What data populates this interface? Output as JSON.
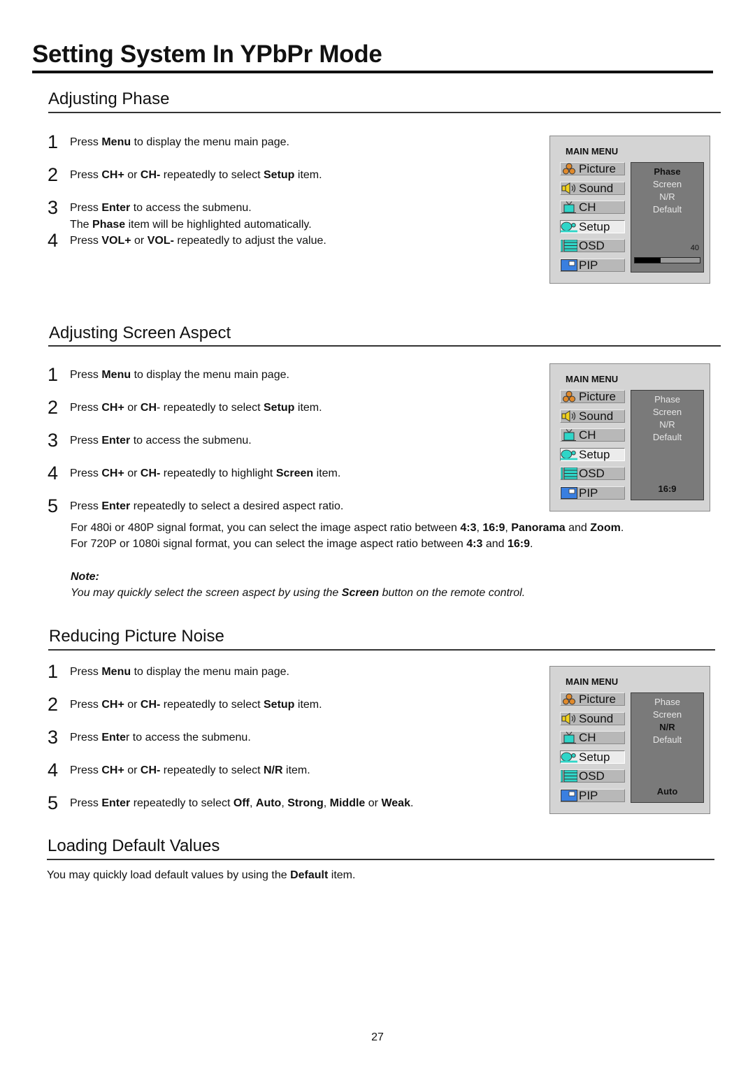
{
  "page": {
    "title": "Setting System In YPbPr Mode",
    "page_number": "27"
  },
  "sections": {
    "phase": {
      "title": "Adjusting Phase",
      "steps": [
        {
          "num": "1",
          "parts": [
            [
              "Press ",
              false
            ],
            [
              "Menu",
              true
            ],
            [
              " to display the menu main page.",
              false
            ]
          ]
        },
        {
          "num": "2",
          "parts": [
            [
              "Press ",
              false
            ],
            [
              "CH+",
              true
            ],
            [
              " or ",
              false
            ],
            [
              "CH-",
              true
            ],
            [
              " repeatedly to select ",
              false
            ],
            [
              "Setup",
              true
            ],
            [
              " item.",
              false
            ]
          ]
        },
        {
          "num": "3",
          "parts": [
            [
              "Press ",
              false
            ],
            [
              "Enter",
              true
            ],
            [
              " to access the submenu.",
              false
            ]
          ],
          "extra": [
            [
              "The ",
              false
            ],
            [
              "Phase",
              true
            ],
            [
              " item will be highlighted automatically.",
              false
            ]
          ]
        },
        {
          "num": "4",
          "parts": [
            [
              "Press ",
              false
            ],
            [
              "VOL+",
              true
            ],
            [
              " or ",
              false
            ],
            [
              "VOL-",
              true
            ],
            [
              " repeatedly to adjust the value.",
              false
            ]
          ]
        }
      ]
    },
    "screen": {
      "title": "Adjusting Screen Aspect",
      "steps": [
        {
          "num": "1",
          "parts": [
            [
              "Press ",
              false
            ],
            [
              "Menu",
              true
            ],
            [
              " to display the menu main page.",
              false
            ]
          ]
        },
        {
          "num": "2",
          "parts": [
            [
              "Press ",
              false
            ],
            [
              "CH+",
              true
            ],
            [
              " or ",
              false
            ],
            [
              "CH",
              true
            ],
            [
              "- repeatedly to select ",
              false
            ],
            [
              "Setup",
              true
            ],
            [
              " item.",
              false
            ]
          ]
        },
        {
          "num": "3",
          "parts": [
            [
              "Press ",
              false
            ],
            [
              "Enter",
              true
            ],
            [
              " to access the submenu.",
              false
            ]
          ]
        },
        {
          "num": "4",
          "parts": [
            [
              "Press ",
              false
            ],
            [
              "CH+",
              true
            ],
            [
              " or ",
              false
            ],
            [
              "CH-",
              true
            ],
            [
              " repeatedly to highlight ",
              false
            ],
            [
              "Screen",
              true
            ],
            [
              " item.",
              false
            ]
          ]
        },
        {
          "num": "5",
          "parts": [
            [
              "Press ",
              false
            ],
            [
              "Enter",
              true
            ],
            [
              " repeatedly to select a desired aspect ratio.",
              false
            ]
          ]
        }
      ],
      "paragraphs": [
        [
          [
            "For 480i or 480P signal format, you can select the image aspect ratio between ",
            false
          ],
          [
            "4:3",
            true
          ],
          [
            ", ",
            false
          ],
          [
            "16:9",
            true
          ],
          [
            ", ",
            false
          ],
          [
            "Panorama",
            true
          ],
          [
            " and ",
            false
          ],
          [
            "Zoom",
            true
          ],
          [
            ".",
            false
          ]
        ],
        [
          [
            "For 720P or 1080i signal format, you can select the image aspect ratio between ",
            false
          ],
          [
            "4:3",
            true
          ],
          [
            " and ",
            false
          ],
          [
            "16:9",
            true
          ],
          [
            ".",
            false
          ]
        ]
      ],
      "note_label": "Note:",
      "note": [
        [
          "You may quickly select the screen aspect by using the ",
          false
        ],
        [
          "Screen",
          true
        ],
        [
          " button on the remote control.",
          false
        ]
      ]
    },
    "noise": {
      "title": "Reducing Picture Noise",
      "steps": [
        {
          "num": "1",
          "parts": [
            [
              "Press ",
              false
            ],
            [
              "Menu",
              true
            ],
            [
              " to display the menu main page.",
              false
            ]
          ]
        },
        {
          "num": "2",
          "parts": [
            [
              "Press ",
              false
            ],
            [
              "CH+",
              true
            ],
            [
              " or ",
              false
            ],
            [
              "CH-",
              true
            ],
            [
              " repeatedly to select ",
              false
            ],
            [
              "Setup",
              true
            ],
            [
              " item.",
              false
            ]
          ]
        },
        {
          "num": "3",
          "parts": [
            [
              "Press ",
              false
            ],
            [
              "Ente",
              true
            ],
            [
              "r to access the submenu.",
              false
            ]
          ]
        },
        {
          "num": "4",
          "parts": [
            [
              "Press ",
              false
            ],
            [
              "CH+",
              true
            ],
            [
              " or ",
              false
            ],
            [
              "CH-",
              true
            ],
            [
              " repeatedly to select ",
              false
            ],
            [
              "N/R",
              true
            ],
            [
              " item.",
              false
            ]
          ]
        },
        {
          "num": "5",
          "parts": [
            [
              "Press ",
              false
            ],
            [
              "Enter",
              true
            ],
            [
              " repeatedly to select ",
              false
            ],
            [
              "Off",
              true
            ],
            [
              ", ",
              false
            ],
            [
              "Auto",
              true
            ],
            [
              ", ",
              false
            ],
            [
              "Strong",
              true
            ],
            [
              ", ",
              false
            ],
            [
              "Middle",
              true
            ],
            [
              " or ",
              false
            ],
            [
              "Weak",
              true
            ],
            [
              ".",
              false
            ]
          ]
        }
      ]
    },
    "default": {
      "title": "Loading Default Values",
      "text": [
        [
          "You may quickly load default values by using the ",
          false
        ],
        [
          "Default",
          true
        ],
        [
          " item.",
          false
        ]
      ]
    }
  },
  "osd": {
    "title": "MAIN MENU",
    "items": [
      {
        "label": "Picture",
        "icon": "picture-icon"
      },
      {
        "label": "Sound",
        "icon": "speaker-icon"
      },
      {
        "label": "CH",
        "icon": "tv-icon"
      },
      {
        "label": "Setup",
        "icon": "setup-icon"
      },
      {
        "label": "OSD",
        "icon": "osd-icon"
      },
      {
        "label": "PIP",
        "icon": "pip-icon"
      }
    ],
    "active_item": "Setup",
    "submenu_options": [
      "Phase",
      "Screen",
      "N/R",
      "Default"
    ],
    "screens": [
      {
        "selected_option": "Phase",
        "value": "40",
        "progress": 0.4
      },
      {
        "selected_option": "",
        "value": "16:9"
      },
      {
        "selected_option": "N/R",
        "value": "Auto"
      }
    ]
  },
  "colors": {
    "osd_background": "#d4d4d4",
    "osd_panel": "#7a7a7a",
    "icon_cyan": "#2fd6c8",
    "icon_orange": "#e08a2c",
    "icon_yellow": "#f2d21c",
    "icon_blue": "#3a7fe0"
  }
}
